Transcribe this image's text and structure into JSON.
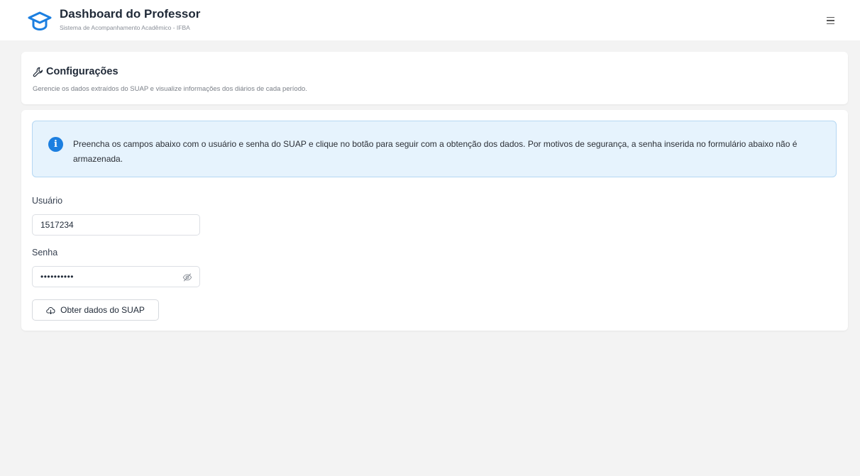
{
  "header": {
    "title": "Dashboard do Professor",
    "subtitle": "Sistema de Acompanhamento Acadêmico - IFBA",
    "logo_icon": "graduation-cap-icon",
    "menu_icon": "hamburger-menu-icon",
    "accent_color": "#1c7fe0"
  },
  "settings": {
    "title": "Configurações",
    "title_icon": "wrench-icon",
    "description": "Gerencie os dados extraídos do SUAP e visualize informações dos diários de cada período."
  },
  "form": {
    "info_icon": "info-icon",
    "info_text": "Preencha os campos abaixo com o usuário e senha do SUAP e clique no botão para seguir com a obtenção dos dados. Por motivos de segurança, a senha inserida no formulário abaixo não é armazenada.",
    "user_label": "Usuário",
    "user_value": "1517234",
    "password_label": "Senha",
    "password_mask": "••••••••••",
    "password_toggle_icon": "eye-off-icon",
    "submit_label": "Obter dados do SUAP",
    "submit_icon": "cloud-download-icon"
  }
}
